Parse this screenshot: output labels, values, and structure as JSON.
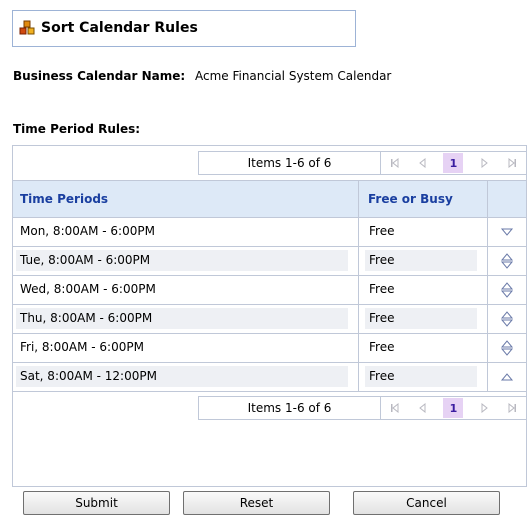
{
  "title": "Sort Calendar Rules",
  "business_calendar": {
    "label": "Business Calendar Name:",
    "value": "Acme Financial System Calendar"
  },
  "rules_label": "Time Period Rules:",
  "pager": {
    "items_text": "Items 1-6 of 6",
    "current_page": "1"
  },
  "table": {
    "headers": {
      "time_periods": "Time Periods",
      "free_or_busy": "Free or Busy"
    },
    "rows": [
      {
        "period": "Mon, 8:00AM  -  6:00PM",
        "status": "Free",
        "sort": "down"
      },
      {
        "period": "Tue, 8:00AM  -  6:00PM",
        "status": "Free",
        "sort": "up-down"
      },
      {
        "period": "Wed, 8:00AM  -  6:00PM",
        "status": "Free",
        "sort": "up-down"
      },
      {
        "period": "Thu, 8:00AM  -  6:00PM",
        "status": "Free",
        "sort": "up-down"
      },
      {
        "period": "Fri, 8:00AM  -  6:00PM",
        "status": "Free",
        "sort": "up-down"
      },
      {
        "period": "Sat, 8:00AM  -  12:00PM",
        "status": "Free",
        "sort": "up"
      }
    ]
  },
  "buttons": {
    "submit": "Submit",
    "reset": "Reset",
    "cancel": "Cancel"
  },
  "colors": {
    "header_bg": "#dde9f7",
    "header_text": "#1a3fa0",
    "page_highlight": "#e6d2f4"
  }
}
